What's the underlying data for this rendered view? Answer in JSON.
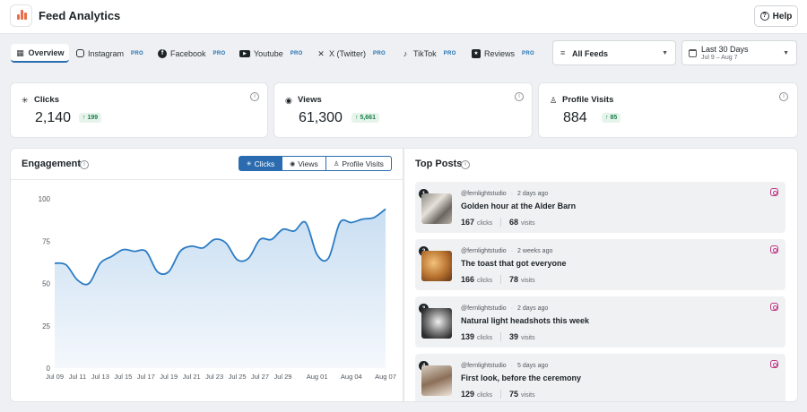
{
  "app": {
    "title": "Feed Analytics",
    "help_label": "Help"
  },
  "tabs": [
    {
      "label": "Overview",
      "pro": ""
    },
    {
      "label": "Instagram",
      "pro": "PRO"
    },
    {
      "label": "Facebook",
      "pro": "PRO"
    },
    {
      "label": "Youtube",
      "pro": "PRO"
    },
    {
      "label": "X (Twitter)",
      "pro": "PRO"
    },
    {
      "label": "TikTok",
      "pro": "PRO"
    },
    {
      "label": "Reviews",
      "pro": "PRO"
    }
  ],
  "filters": {
    "feed": "All Feeds",
    "range_label": "Last 30 Days",
    "range_dates": "Jul 9 – Aug 7"
  },
  "stats": [
    {
      "label": "Clicks",
      "value": "2,140",
      "change": "↑ 199"
    },
    {
      "label": "Views",
      "value": "61,300",
      "change": "↑ 5,661"
    },
    {
      "label": "Profile Visits",
      "value": "884",
      "change": "↑ 85"
    }
  ],
  "engagement": {
    "title": "Engagement",
    "segments": [
      "Clicks",
      "Views",
      "Profile Visits"
    ]
  },
  "chart_data": {
    "type": "area",
    "x": [
      "Jul 09",
      "Jul 10",
      "Jul 11",
      "Jul 12",
      "Jul 13",
      "Jul 14",
      "Jul 15",
      "Jul 16",
      "Jul 17",
      "Jul 18",
      "Jul 19",
      "Jul 20",
      "Jul 21",
      "Jul 22",
      "Jul 23",
      "Jul 24",
      "Jul 25",
      "Jul 26",
      "Jul 27",
      "Jul 28",
      "Jul 29",
      "Jul 30",
      "Jul 31",
      "Aug 01",
      "Aug 02",
      "Aug 03",
      "Aug 04",
      "Aug 05",
      "Aug 06",
      "Aug 07"
    ],
    "values": [
      62,
      61,
      52,
      50,
      62,
      66,
      70,
      69,
      69,
      57,
      57,
      69,
      72,
      71,
      76,
      74,
      64,
      65,
      76,
      76,
      82,
      81,
      86,
      67,
      65,
      86,
      86,
      88,
      89,
      94
    ],
    "tick_labels": [
      "Jul 09",
      "Jul 11",
      "Jul 13",
      "Jul 15",
      "Jul 17",
      "Jul 19",
      "Jul 21",
      "Jul 23",
      "Jul 25",
      "Jul 27",
      "Jul 29",
      "Aug 01",
      "Aug 04",
      "Aug 07"
    ],
    "y_ticks": [
      0,
      25,
      50,
      75,
      100
    ],
    "ylim": [
      0,
      100
    ],
    "color": "#2b7bc4",
    "fill": "#d4e6f6"
  },
  "top_posts": {
    "title": "Top Posts",
    "clicks_label": "clicks",
    "visits_label": "visits",
    "items": [
      {
        "rank": "1",
        "handle": "@fernlightstudio",
        "time": "2 days ago",
        "title": "Golden hour at the Alder Barn",
        "clicks": "167",
        "visits": "68"
      },
      {
        "rank": "2",
        "handle": "@fernlightstudio",
        "time": "2 weeks ago",
        "title": "The toast that got everyone",
        "clicks": "166",
        "visits": "78"
      },
      {
        "rank": "3",
        "handle": "@fernlightstudio",
        "time": "2 days ago",
        "title": "Natural light headshots this week",
        "clicks": "139",
        "visits": "39"
      },
      {
        "rank": "4",
        "handle": "@fernlightstudio",
        "time": "5 days ago",
        "title": "First look, before the ceremony",
        "clicks": "129",
        "visits": "75"
      }
    ]
  }
}
